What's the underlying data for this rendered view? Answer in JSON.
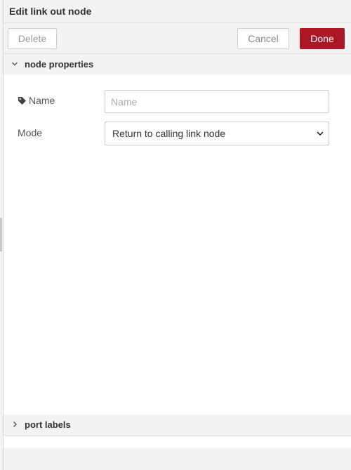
{
  "tray": {
    "title": "Edit link out node"
  },
  "toolbar": {
    "delete_label": "Delete",
    "cancel_label": "Cancel",
    "done_label": "Done"
  },
  "sections": {
    "node_properties": {
      "label": "node properties",
      "expanded": true,
      "icon": "chevron-down-icon"
    },
    "port_labels": {
      "label": "port labels",
      "expanded": false,
      "icon": "chevron-right-icon"
    }
  },
  "form": {
    "name": {
      "label": "Name",
      "icon": "tag-icon",
      "value": "",
      "placeholder": "Name"
    },
    "mode": {
      "label": "Mode",
      "selected": "Return to calling link node"
    }
  },
  "colors": {
    "done_button": "#ad1625",
    "header_bg": "#f3f3f3",
    "border": "#cccccc"
  }
}
